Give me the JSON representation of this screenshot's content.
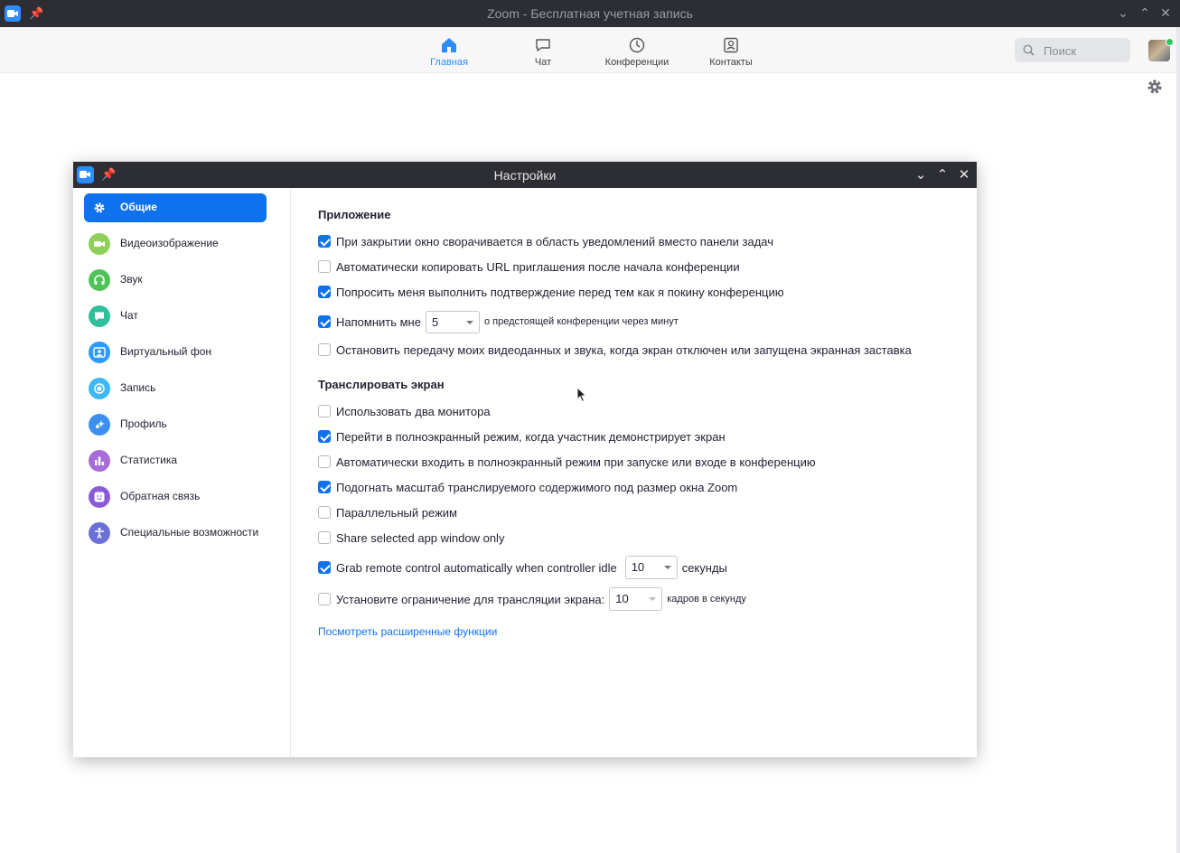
{
  "window": {
    "title": "Zoom - Бесплатная учетная запись"
  },
  "nav": {
    "items": [
      {
        "label": "Главная",
        "icon": "home-icon"
      },
      {
        "label": "Чат",
        "icon": "chat-icon"
      },
      {
        "label": "Конференции",
        "icon": "clock-icon"
      },
      {
        "label": "Контакты",
        "icon": "contacts-icon"
      }
    ],
    "active": "Главная"
  },
  "search": {
    "placeholder": "Поиск"
  },
  "dialog": {
    "title": "Настройки",
    "sidebar": {
      "items": [
        {
          "label": "Общие",
          "icon": "gear-icon",
          "color": "#0e72ed"
        },
        {
          "label": "Видеоизображение",
          "icon": "video-icon",
          "color": "#8fcf5a"
        },
        {
          "label": "Звук",
          "icon": "headphones-icon",
          "color": "#4fc35a"
        },
        {
          "label": "Чат",
          "icon": "chat-icon",
          "color": "#2fbf9a"
        },
        {
          "label": "Виртуальный фон",
          "icon": "virtual-background-icon",
          "color": "#2d9cff"
        },
        {
          "label": "Запись",
          "icon": "record-icon",
          "color": "#3db8f5"
        },
        {
          "label": "Профиль",
          "icon": "profile-icon",
          "color": "#3a8ff0"
        },
        {
          "label": "Статистика",
          "icon": "statistics-icon",
          "color": "#a66cd8"
        },
        {
          "label": "Обратная связь",
          "icon": "feedback-icon",
          "color": "#8b5bd6"
        },
        {
          "label": "Специальные возможности",
          "icon": "accessibility-icon",
          "color": "#6b6fd6"
        }
      ],
      "active": "Общие"
    },
    "app_section": {
      "title": "Приложение",
      "opt_minimize": {
        "label": "При закрытии окно сворачивается в область уведомлений вместо панели задач",
        "checked": true
      },
      "opt_copy_url": {
        "label": "Автоматически копировать URL приглашения после начала конференции",
        "checked": false
      },
      "opt_confirm_leave": {
        "label": "Попросить меня выполнить подтверждение перед тем как я покину конференцию",
        "checked": true
      },
      "opt_remind": {
        "label": "Напомнить мне",
        "checked": true,
        "value": "5",
        "suffix": "о предстоящей конференции через минут"
      },
      "opt_stop_video": {
        "label": "Остановить передачу моих видеоданных и звука, когда экран отключен или запущена экранная заставка",
        "checked": false
      }
    },
    "share_section": {
      "title": "Транслировать экран",
      "opt_dual_monitor": {
        "label": "Использовать два монитора",
        "checked": false
      },
      "opt_fullscreen_share": {
        "label": "Перейти в полноэкранный режим, когда участник демонстрирует экран",
        "checked": true
      },
      "opt_auto_fullscreen": {
        "label": "Автоматически входить в полноэкранный режим при запуске или входе в конференцию",
        "checked": false
      },
      "opt_fit_window": {
        "label": "Подогнать масштаб транслируемого содержимого под размер окна Zoom",
        "checked": true
      },
      "opt_side_by_side": {
        "label": "Параллельный режим",
        "checked": false
      },
      "opt_app_window": {
        "label": "Share selected app window only",
        "checked": false
      },
      "opt_grab_remote": {
        "label": "Grab remote control automatically when controller idle",
        "checked": true,
        "value": "10",
        "suffix": "секунды"
      },
      "opt_limit_fps": {
        "label": "Установите ограничение для трансляции экрана:",
        "checked": false,
        "value": "10",
        "suffix": "кадров в секунду"
      }
    },
    "advanced_link": "Посмотреть расширенные функции"
  }
}
